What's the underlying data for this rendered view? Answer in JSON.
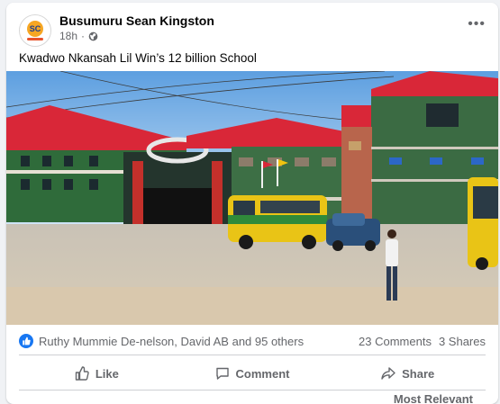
{
  "post": {
    "author": "Busumuru Sean Kingston",
    "time": "18h",
    "visibility_icon": "globe-icon",
    "avatar_text": "SC",
    "caption": "Kwadwo Nkansah Lil Win’s  12 billion School",
    "more_icon": "more-options-icon",
    "more_label": "•••"
  },
  "reactions": {
    "icon": "like-icon",
    "reactors": "Ruthy Mummie De-nelson, David AB and 95 others",
    "comments": "23 Comments",
    "shares": "3 Shares"
  },
  "actions": {
    "like": "Like",
    "comment": "Comment",
    "share": "Share"
  },
  "sort_label": "Most Relevant",
  "colors": {
    "brand_blue": "#1877f2",
    "roof_red": "#d6293b",
    "wall_green": "#2f6b3a",
    "bus_yellow": "#e9c416"
  }
}
